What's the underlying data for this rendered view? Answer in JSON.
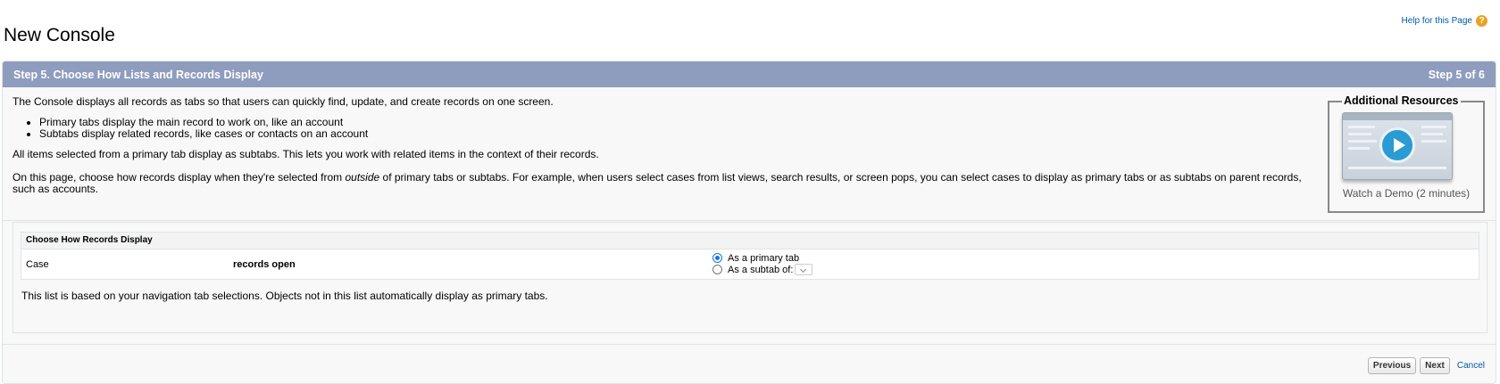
{
  "page": {
    "title": "New Console",
    "help_link": "Help for this Page",
    "help_icon_glyph": "?"
  },
  "wizard": {
    "step_title": "Step 5. Choose How Lists and Records Display",
    "step_count": "Step 5 of 6",
    "header_color": "#8e9dbe"
  },
  "intro": {
    "p1": "The Console displays all records as tabs so that users can quickly find, update, and create records on one screen.",
    "bullets": [
      "Primary tabs display the main record to work on, like an account",
      "Subtabs display related records, like cases or contacts on an account"
    ],
    "p2": "All items selected from a primary tab display as subtabs. This lets you work with related items in the context of their records.",
    "p3_before": "On this page, choose how records display when they're selected from ",
    "p3_em": "outside",
    "p3_after": " of primary tabs or subtabs. For example, when users select cases from list views, search results, or screen pops, you can select cases to display as primary tabs or as subtabs on parent records, such as accounts."
  },
  "resources": {
    "title": "Additional Resources",
    "demo_label": "Watch a Demo (2 minutes)"
  },
  "records_display": {
    "section_title": "Choose How Records Display",
    "rows": [
      {
        "object": "Case",
        "open_label": "records open",
        "options": [
          "As a primary tab",
          "As a subtab of:"
        ],
        "selected_option": "As a primary tab"
      }
    ],
    "note": "This list is based on your navigation tab selections. Objects not in this list automatically display as primary tabs."
  },
  "footer": {
    "previous": "Previous",
    "next": "Next",
    "cancel": "Cancel"
  }
}
